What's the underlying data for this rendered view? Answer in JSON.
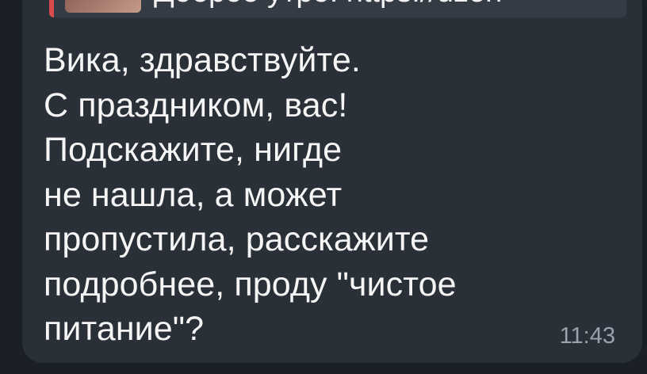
{
  "reply": {
    "preview_text": "Доброе утро. https://dzen"
  },
  "message": {
    "text": "Вика, здравствуйте.\nС праздником, вас!\nПодскажите, нигде\nне нашла, а может\nпропустила, расскажите\nподробнее, проду \"чистое\nпитание\"?",
    "time": "11:43"
  },
  "colors": {
    "bubble": "#2a3038",
    "accent": "#d94b4b",
    "text": "#f5f5f5"
  }
}
